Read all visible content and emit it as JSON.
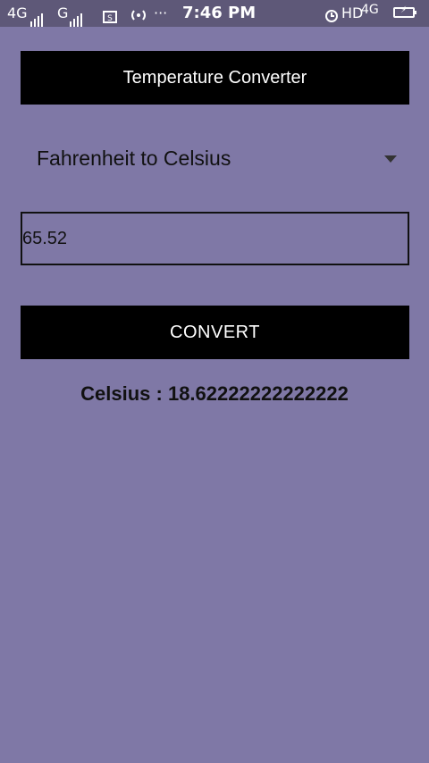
{
  "status_bar": {
    "network_1": "4G",
    "network_2": "G",
    "time": "7:46 PM",
    "hd": "HD",
    "network_3": "4G",
    "more": "···"
  },
  "app": {
    "title": "Temperature Converter",
    "conversion_mode": "Fahrenheit to Celsius",
    "input_value": "65.52",
    "convert_label": "CONVERT",
    "result_text": "Celsius : 18.62222222222222"
  }
}
